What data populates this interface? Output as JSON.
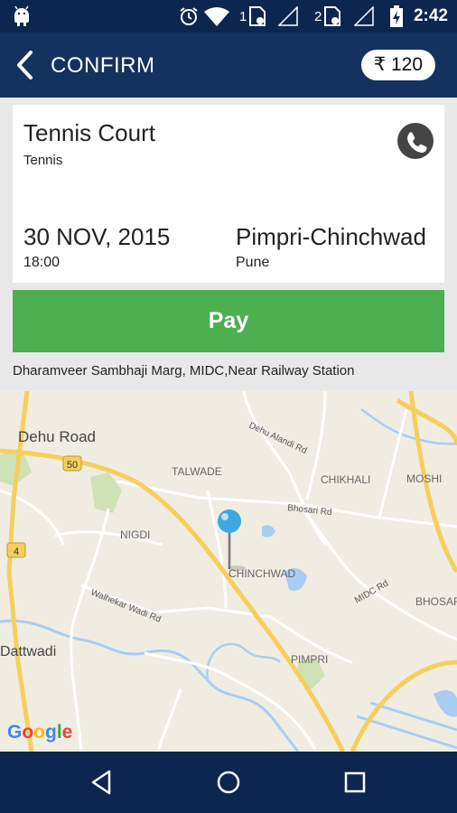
{
  "status_bar": {
    "time": "2:42",
    "sim1_label": "1",
    "sim2_label": "2",
    "icons": [
      "android-icon",
      "alarm-icon",
      "wifi-icon",
      "sim-card-icon",
      "signal-icon",
      "battery-charging-icon"
    ]
  },
  "app_bar": {
    "title": "CONFIRM",
    "price": "₹ 120"
  },
  "booking": {
    "venue_name": "Tennis Court",
    "sport": "Tennis",
    "date": "30 NOV, 2015",
    "time": "18:00",
    "city": "Pimpri-Chinchwad",
    "state": "Pune"
  },
  "pay_button": {
    "label": "Pay"
  },
  "address": "Dharamveer Sambhaji Marg, MIDC,Near Railway Station",
  "map": {
    "labels": {
      "dehu_road": "Dehu Road",
      "dehu_alandi_rd": "Dehu Alandi Rd",
      "talwade": "TALWADE",
      "chikhali": "CHIKHALI",
      "moshi": "MOSHI",
      "bhosari_rd": "Bhosari Rd",
      "nigdi": "NIGDI",
      "chinchwad": "CHINCHWAD",
      "midc_rd": "MIDC Rd",
      "bhosari": "BHOSARI",
      "walhekar_wadi_rd": "Walhekar Wadi Rd",
      "dattwadi": "Dattwadi",
      "pimpri": "PIMPRI",
      "shield_50": "50",
      "shield_4": "4"
    },
    "google_logo": [
      "G",
      "o",
      "o",
      "g",
      "l",
      "e"
    ],
    "google_colors": [
      "#4285F4",
      "#EA4335",
      "#FBBC05",
      "#4285F4",
      "#34A853",
      "#EA4335"
    ]
  },
  "colors": {
    "status_bar": "#0d2650",
    "app_bar": "#14315f",
    "pay_green": "#4caf50",
    "map_background": "#f1ece2",
    "pin": "#40a8e0"
  }
}
